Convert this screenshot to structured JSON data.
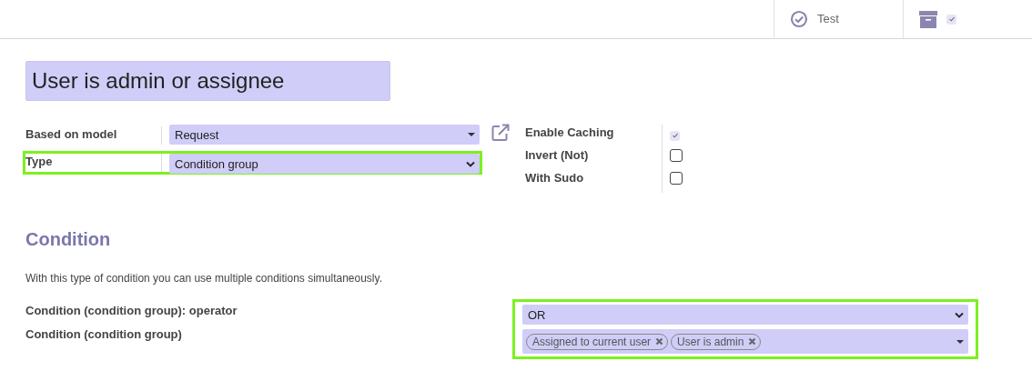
{
  "header": {
    "test_button": {
      "label": "Test"
    },
    "archive_toggle": {
      "checked": true
    }
  },
  "name_field": {
    "value": "User is admin or assignee"
  },
  "fields_left": [
    {
      "label": "Based on model",
      "value": "Request",
      "kind": "many2one",
      "highlighted": false,
      "link": true
    },
    {
      "label": "Type",
      "value": "Condition group",
      "kind": "select",
      "highlighted": true,
      "link": false
    }
  ],
  "fields_right": [
    {
      "label": "Enable Caching",
      "checked": true
    },
    {
      "label": "Invert (Not)",
      "checked": false
    },
    {
      "label": "With Sudo",
      "checked": false
    }
  ],
  "section": {
    "title": "Condition",
    "description": "With this type of condition you can use multiple conditions simultaneously."
  },
  "condition_fields": [
    {
      "label": "Condition (condition group): operator",
      "kind": "select",
      "value": "OR"
    },
    {
      "label": "Condition (condition group)",
      "kind": "tags",
      "tags": [
        "Assigned to current user",
        "User is admin"
      ]
    }
  ],
  "condition_highlighted": true
}
